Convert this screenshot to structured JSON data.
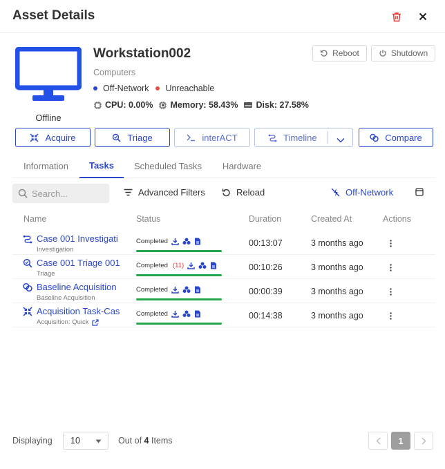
{
  "dialog": {
    "title": "Asset Details"
  },
  "asset": {
    "name": "Workstation002",
    "category": "Computers",
    "icon_label": "Offline",
    "network_status": "Off-Network",
    "reachability": "Unreachable",
    "cpu": "CPU: 0.00%",
    "memory": "Memory: 58.43%",
    "disk": "Disk: 27.58%"
  },
  "header_buttons": {
    "reboot": "Reboot",
    "shutdown": "Shutdown"
  },
  "actions": {
    "acquire": "Acquire",
    "triage": "Triage",
    "interact": "interACT",
    "timeline": "Timeline",
    "compare": "Compare"
  },
  "tabs": [
    "Information",
    "Tasks",
    "Scheduled Tasks",
    "Hardware"
  ],
  "active_tab": "Tasks",
  "toolbar": {
    "search_placeholder": "Search...",
    "advanced_filters": "Advanced Filters",
    "reload": "Reload",
    "network_filter": "Off-Network"
  },
  "table": {
    "columns": [
      "Name",
      "Status",
      "Duration",
      "Created At",
      "Actions"
    ],
    "rows": [
      {
        "icon": "investigation-icon",
        "name": "Case 001 Investigati",
        "subtitle": "Investigation",
        "status": "Completed",
        "count": "",
        "duration": "00:13:07",
        "created": "3 months ago"
      },
      {
        "icon": "triage-icon",
        "name": "Case 001 Triage 001",
        "subtitle": "Triage",
        "status": "Completed",
        "count": "(11)",
        "duration": "00:10:26",
        "created": "3 months ago"
      },
      {
        "icon": "baseline-icon",
        "name": "Baseline Acquisition",
        "subtitle": "Baseline Acquisition",
        "status": "Completed",
        "count": "",
        "duration": "00:00:39",
        "created": "3 months ago"
      },
      {
        "icon": "acquisition-icon",
        "name": "Acquisition Task-Cas",
        "subtitle": "Acquisition: Quick",
        "status": "Completed",
        "count": "",
        "duration": "00:14:38",
        "created": "3 months ago"
      }
    ]
  },
  "footer": {
    "displaying": "Displaying",
    "page_size": "10",
    "out_of": "Out of",
    "total": "4",
    "items": "Items",
    "current_page": "1"
  },
  "colors": {
    "primary": "#2b47c9",
    "success": "#22a84a",
    "danger": "#e53935",
    "offline_dot": "#2b47c9",
    "unreachable_dot": "#e5534b"
  }
}
